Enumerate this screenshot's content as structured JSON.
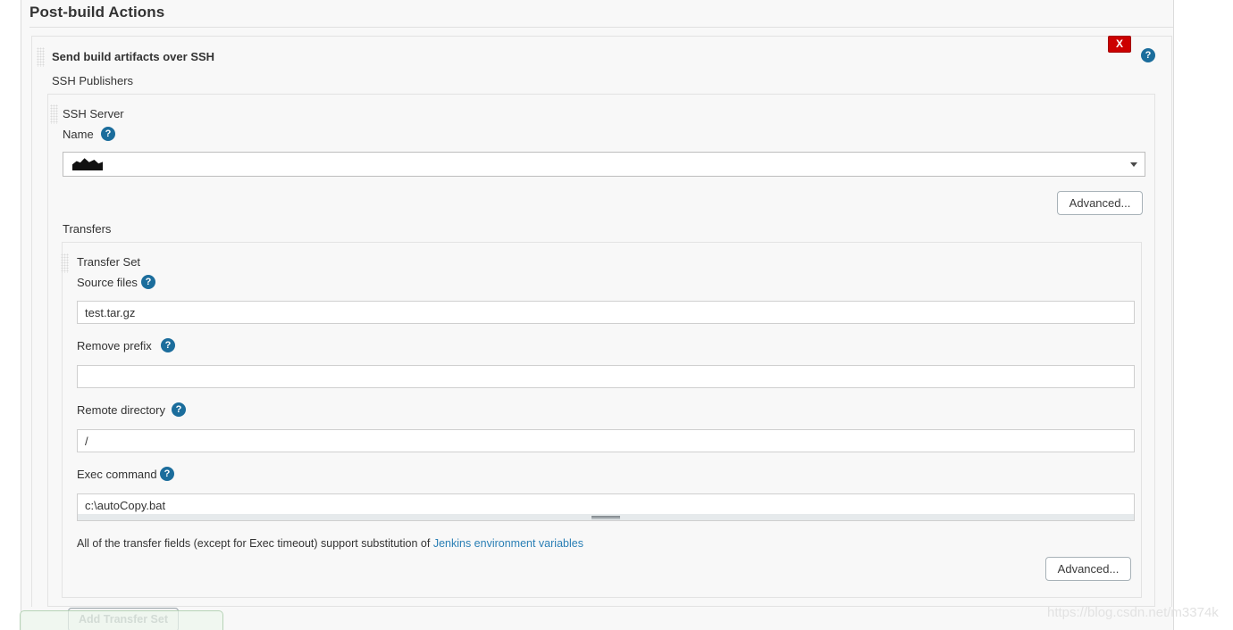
{
  "page": {
    "section_title": "Post-build Actions",
    "watermark": "https://blog.csdn.net/m3374k"
  },
  "publisher": {
    "title": "Send build artifacts over SSH",
    "delete_label": "X",
    "help_label": "?",
    "publishers_label": "SSH Publishers"
  },
  "ssh_server": {
    "legend": "SSH Server",
    "name_label": "Name",
    "name_help": "?",
    "name_value": "",
    "name_value_redacted": true,
    "advanced_label": "Advanced..."
  },
  "transfers": {
    "legend": "Transfers",
    "transfer_set_legend": "Transfer Set",
    "fields": [
      {
        "id": "source-files",
        "label": "Source files",
        "help": "?",
        "value": "test.tar.gz",
        "placeholder": ""
      },
      {
        "id": "remove-prefix",
        "label": "Remove prefix",
        "help": "?",
        "value": "",
        "placeholder": ""
      },
      {
        "id": "remote-directory",
        "label": "Remote directory",
        "help": "?",
        "value": "/",
        "placeholder": ""
      },
      {
        "id": "exec-command",
        "label": "Exec command",
        "help": "?",
        "value": "c:\\autoCopy.bat",
        "placeholder": ""
      }
    ],
    "hint_prefix": "All of the transfer fields (except for Exec timeout) support substitution of ",
    "hint_link": "Jenkins environment variables",
    "advanced_label": "Advanced...",
    "add_transfer_set_label": "Add Transfer Set"
  },
  "colors": {
    "accent_help": "#1b6d9c",
    "delete_red": "#cc0000",
    "link_blue": "#2a7fb5",
    "panel_bg": "#f8f8f8",
    "border": "#e3e3e3"
  }
}
